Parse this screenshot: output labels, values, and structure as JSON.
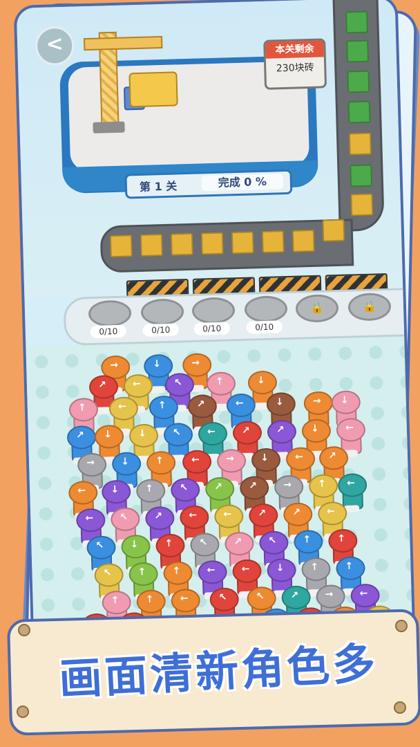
{
  "header": {
    "back_icon": "chevron-left-icon",
    "back_glyph": "<"
  },
  "sign": {
    "title": "本关剩余",
    "remaining": "230块砖"
  },
  "level": {
    "label": "第 1 关",
    "progress_label": "完成 0 %"
  },
  "slots": [
    {
      "label": "0/10",
      "locked": false
    },
    {
      "label": "0/10",
      "locked": false
    },
    {
      "label": "0/10",
      "locked": false
    },
    {
      "label": "0/10",
      "locked": false
    },
    {
      "label": "",
      "locked": true
    },
    {
      "label": "",
      "locked": true
    }
  ],
  "banner": {
    "text": "画面清新角色多"
  },
  "colors": {
    "red": "#e0443a",
    "blue": "#3b8fe0",
    "purple": "#8a57d6",
    "teal": "#2fa6a0",
    "orange": "#ee8a32",
    "yellow": "#e6c34a",
    "pink": "#f19bb0",
    "gray": "#a8a8ae",
    "green": "#88c44a",
    "brown": "#9a5a3e"
  }
}
